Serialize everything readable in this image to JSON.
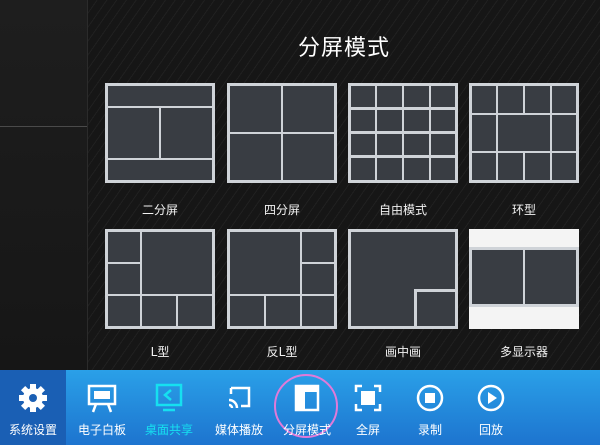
{
  "title": "分屏模式",
  "modes": [
    {
      "label": "二分屏"
    },
    {
      "label": "四分屏"
    },
    {
      "label": "自由模式"
    },
    {
      "label": "环型"
    },
    {
      "label": "L型"
    },
    {
      "label": "反L型"
    },
    {
      "label": "画中画"
    },
    {
      "label": "多显示器"
    }
  ],
  "taskbar": {
    "items": [
      {
        "label": "系统设置",
        "icon": "gear-icon"
      },
      {
        "label": "电子白板",
        "icon": "whiteboard-icon"
      },
      {
        "label": "桌面共享",
        "icon": "desktop-share-icon",
        "color": "#16e0f0"
      },
      {
        "label": "媒体播放",
        "icon": "media-cast-icon"
      },
      {
        "label": "分屏模式",
        "icon": "split-screen-icon",
        "active": true
      },
      {
        "label": "全屏",
        "icon": "fullscreen-icon"
      },
      {
        "label": "录制",
        "icon": "record-icon"
      },
      {
        "label": "回放",
        "icon": "playback-icon"
      }
    ]
  },
  "colors": {
    "cell": "#393d43",
    "grid": "#cfd3d8",
    "taskbar": "#1d74cf",
    "active_ring": "#e07ad9"
  }
}
